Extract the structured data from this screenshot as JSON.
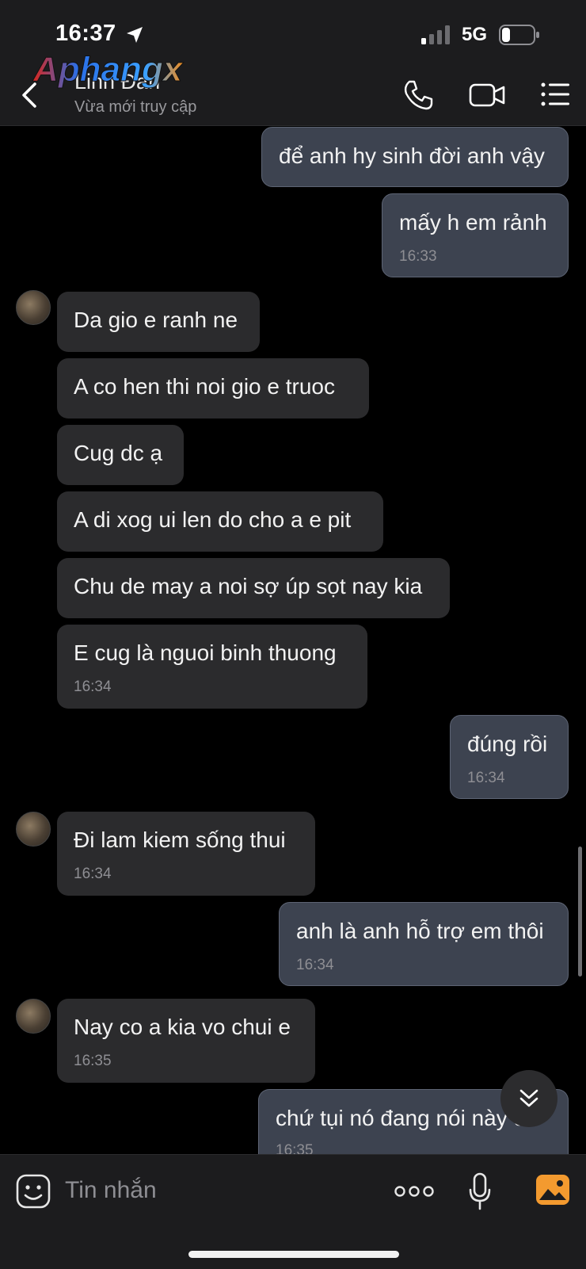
{
  "status_bar": {
    "time": "16:37",
    "network": "5G"
  },
  "header": {
    "watermark": "Aphangx",
    "contact_name": "Linh Đan",
    "contact_status": "Vừa mới truy cập"
  },
  "messages": [
    {
      "from": "me",
      "text": "để anh hy sinh đời anh vậy",
      "time": ""
    },
    {
      "from": "me",
      "text": "mấy h em rảnh",
      "time": "16:33"
    },
    {
      "from": "them",
      "text": "Da gio e ranh ne",
      "time": ""
    },
    {
      "from": "them",
      "text": "A co hen thi noi gio e truoc",
      "time": ""
    },
    {
      "from": "them",
      "text": "Cug dc ạ",
      "time": ""
    },
    {
      "from": "them",
      "text": "A di xog ui len do cho a e pit",
      "time": ""
    },
    {
      "from": "them",
      "text": "Chu de may a noi sợ úp sọt nay kia",
      "time": ""
    },
    {
      "from": "them",
      "text": "E cug là nguoi binh thuong",
      "time": "16:34"
    },
    {
      "from": "me",
      "text": "đúng rồi",
      "time": "16:34"
    },
    {
      "from": "them",
      "text": "Đi lam kiem sống thui",
      "time": "16:34"
    },
    {
      "from": "me",
      "text": "anh là anh hỗ trợ em thôi",
      "time": "16:34"
    },
    {
      "from": "them",
      "text": "Nay co a kia vo chui e",
      "time": "16:35"
    },
    {
      "from": "me",
      "text": "chứ tụi nó đang nói này đ",
      "time": "16:35"
    }
  ],
  "input": {
    "placeholder": "Tin nhắn"
  },
  "colors": {
    "bubble_them": "#2b2b2d",
    "bubble_me": "#3d4350",
    "gallery_accent": "#f39a2f"
  }
}
